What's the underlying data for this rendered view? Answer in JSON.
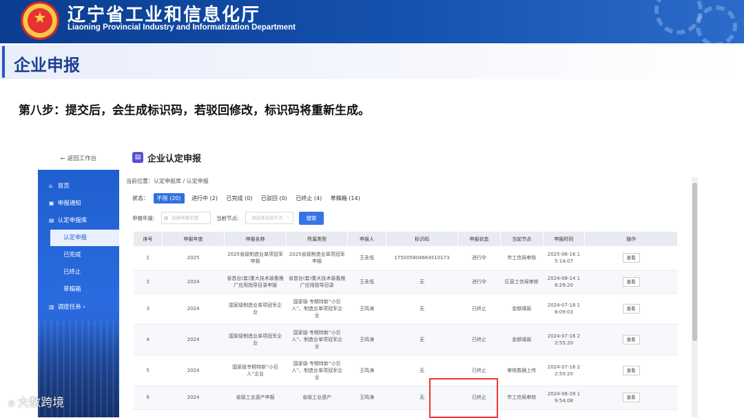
{
  "banner": {
    "title": "辽宁省工业和信息化厅",
    "subtitle": "Liaoning Provincial Industry and Informatization Department",
    "emblem_glyph": "★"
  },
  "section": {
    "title": "企业申报"
  },
  "step_text": "第八步：提交后，会生成标识码，若驳回修改，标识码将重新生成。",
  "app": {
    "back_link": "← 返回工作台",
    "sidebar": {
      "items": [
        {
          "label": "首页",
          "icon": "home-icon",
          "glyph": "⌂"
        },
        {
          "label": "申报通知",
          "icon": "bell-icon",
          "glyph": "▣"
        },
        {
          "label": "认定申报库",
          "icon": "folder-icon",
          "glyph": "▤"
        },
        {
          "label": "认定申报",
          "icon": "",
          "glyph": ""
        },
        {
          "label": "已完成",
          "icon": "",
          "glyph": ""
        },
        {
          "label": "已终止",
          "icon": "",
          "glyph": ""
        },
        {
          "label": "草稿箱",
          "icon": "",
          "glyph": ""
        },
        {
          "label": "调度任务",
          "icon": "task-icon",
          "glyph": "▥",
          "arrow": "›"
        }
      ]
    },
    "page_title": "企业认定申报",
    "page_icon_glyph": "▤",
    "breadcrumb": "当前位置：认定申报库 / 认定申报",
    "status": {
      "label": "状态：",
      "chips": [
        "不限 (20)",
        "进行中 (2)",
        "已完成 (0)",
        "已驳回 (0)",
        "已终止 (4)",
        "草稿箱 (14)"
      ]
    },
    "filters": {
      "year_label": "申报年度:",
      "year_placeholder": "选择申报年度",
      "node_label": "当前节点:",
      "node_placeholder": "请选择当前节点",
      "node_arrow": "⌄",
      "calendar_glyph": "▦",
      "search_label": "搜索"
    },
    "table": {
      "headers": [
        "序号",
        "申报年度",
        "申报名称",
        "所属类型",
        "申报人",
        "标识码",
        "申报状态",
        "当前节点",
        "申报时间",
        "操作"
      ],
      "rows": [
        [
          "1",
          "2025",
          "2025省级制造业单项冠军\n申报",
          "2025省级制造业单项冠军\n申报",
          "王永恒",
          "175005804664510173",
          "进行中",
          "市工信局审核",
          "2025-06-16 1\n5:14:07",
          "查看"
        ],
        [
          "2",
          "2024",
          "省首台(套)重大技术装备推\n广应用指导目录申报",
          "省首台(套)重大技术装备推\n广应用指导目录",
          "王永恒",
          "无",
          "进行中",
          "区县工信局审核",
          "2024-08-14 1\n6:29:20",
          "查看"
        ],
        [
          "3",
          "2024",
          "国家级制造业单项冠军企\n业",
          "国家级·专精特新“小巨\n人”、制造业单项冠军企\n业",
          "王鸣涛",
          "无",
          "已终止",
          "金额填报",
          "2024-07-18 1\n8:09:03",
          "查看"
        ],
        [
          "4",
          "2024",
          "国家级制造业单项冠军企\n业",
          "国家级·专精特新“小巨\n人”、制造业单项冠军企\n业",
          "王鸣涛",
          "无",
          "已终止",
          "金额填报",
          "2024-07-16 2\n2:55:20",
          "查看"
        ],
        [
          "5",
          "2024",
          "国家级专精特新“小巨\n人”企业",
          "国家级·专精特新“小巨\n人”、制造业单项冠军企\n业",
          "王鸣涛",
          "无",
          "已终止",
          "审核数据上传",
          "2024-07-16 2\n2:50:20",
          "查看"
        ],
        [
          "6",
          "2024",
          "省级工业遗产申报",
          "省级工业遗产",
          "王鸣涛",
          "无",
          "已终止",
          "市工信局审核",
          "2024-06-28 1\n9:54:08",
          "查看"
        ]
      ]
    }
  },
  "watermark": {
    "text": "大数跨境",
    "glyph": "ʚ"
  }
}
